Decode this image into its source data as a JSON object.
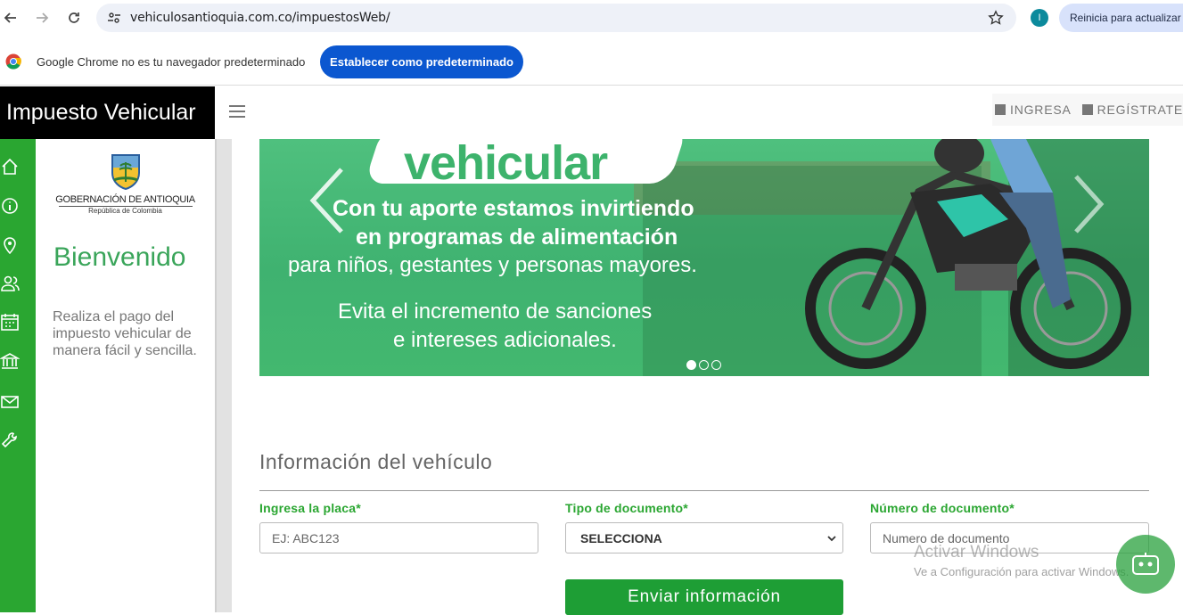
{
  "browser": {
    "url": "vehiculosantioquia.com.co/impuestosWeb/",
    "profile_initial": "I",
    "restart_label": "Reinicia para actualizar"
  },
  "infobar": {
    "message": "Google Chrome no es tu navegador predeterminado",
    "button_label": "Establecer como predeterminado"
  },
  "site": {
    "brand": "Impuesto Vehicular",
    "login": "INGRESA",
    "register": "REGÍSTRATE"
  },
  "sidebar": {
    "gov_name": "GOBERNACIÓN DE ANTIOQUIA",
    "gov_sub": "República de Colombia",
    "welcome": "Bienvenido",
    "intro": "Realiza el pago del impuesto vehicular de manera fácil y sencilla."
  },
  "rail_icons": [
    "home-icon",
    "info-icon",
    "location-icon",
    "users-icon",
    "calendar-icon",
    "bank-icon",
    "mail-icon",
    "tools-icon"
  ],
  "banner": {
    "title": "vehicular",
    "line1": "Con tu aporte estamos invirtiendo",
    "line2": "en programas de alimentación",
    "line3": "para niños, gestantes y personas mayores.",
    "line4": "Evita el incremento de sanciones",
    "line5": "e intereses adicionales.",
    "slides": 3,
    "active_slide": 1
  },
  "form": {
    "title": "Información del vehículo",
    "plate_label": "Ingresa la placa*",
    "plate_placeholder": "EJ: ABC123",
    "doc_type_label": "Tipo de documento*",
    "doc_type_value": "SELECCIONA",
    "doc_number_label": "Número de documento*",
    "doc_number_placeholder": "Numero de documento",
    "submit_label": "Enviar información"
  },
  "watermark": {
    "line1": "Activar Windows",
    "line2": "Ve a Configuración para activar Windows."
  }
}
